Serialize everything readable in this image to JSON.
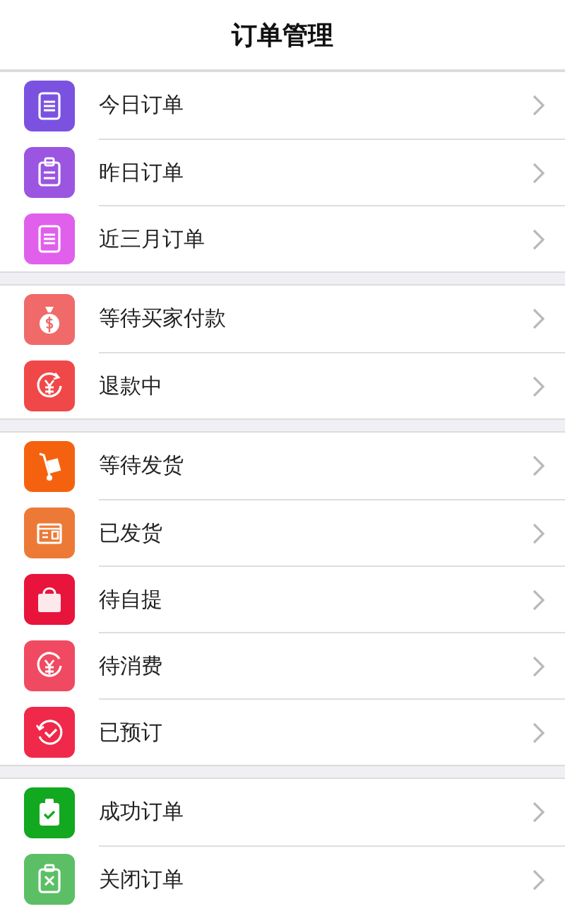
{
  "header": {
    "title": "订单管理"
  },
  "groups": [
    {
      "items": [
        {
          "label": "今日订单",
          "kind": "list",
          "color": "#7b52e0"
        },
        {
          "label": "昨日订单",
          "kind": "clipboard",
          "color": "#9b55e0"
        },
        {
          "label": "近三月订单",
          "kind": "list",
          "color": "#e060ec"
        }
      ]
    },
    {
      "items": [
        {
          "label": "等待买家付款",
          "kind": "money-bag",
          "color": "#f06a6a"
        },
        {
          "label": "退款中",
          "kind": "yen-refund",
          "color": "#f04848"
        }
      ]
    },
    {
      "items": [
        {
          "label": "等待发货",
          "kind": "trolley",
          "color": "#f5620f"
        },
        {
          "label": "已发货",
          "kind": "box",
          "color": "#ec7a36"
        },
        {
          "label": "待自提",
          "kind": "bag",
          "color": "#e8143c"
        },
        {
          "label": "待消费",
          "kind": "yen",
          "color": "#f04a62"
        },
        {
          "label": "已预订",
          "kind": "clock-check",
          "color": "#f0284a"
        }
      ]
    },
    {
      "items": [
        {
          "label": "成功订单",
          "kind": "clipboard-check",
          "color": "#12a820"
        },
        {
          "label": "关闭订单",
          "kind": "clipboard-x",
          "color": "#5cbf66"
        }
      ]
    }
  ]
}
